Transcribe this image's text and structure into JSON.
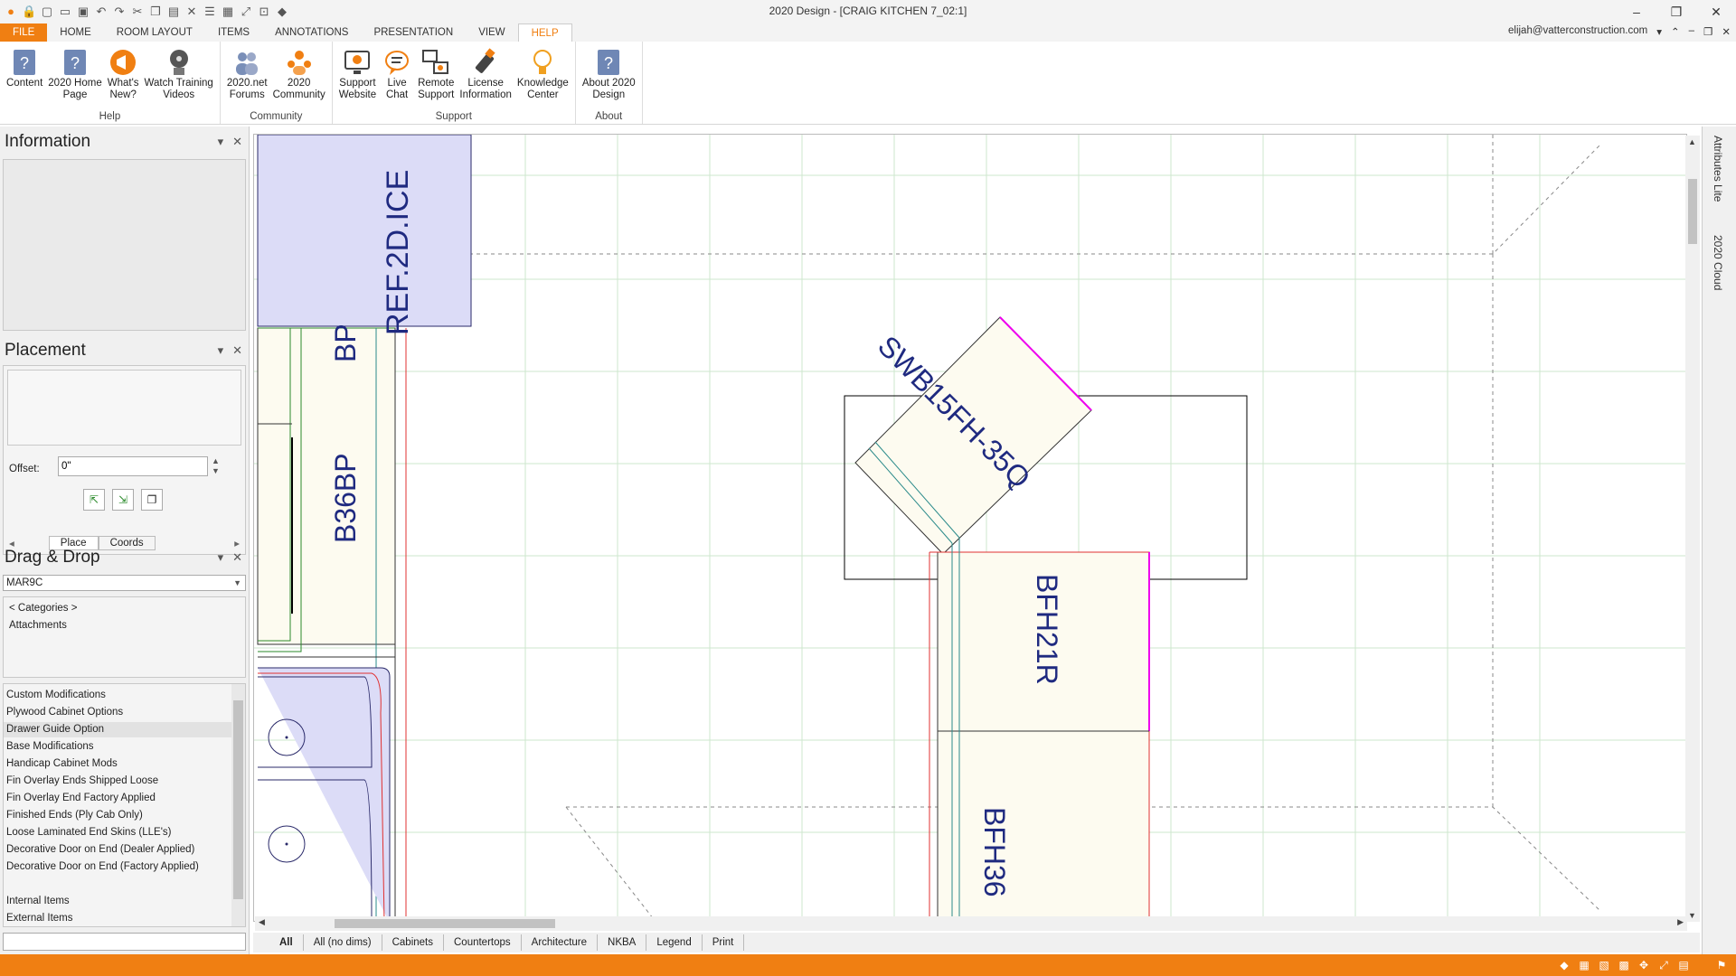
{
  "window": {
    "title": "2020 Design - [CRAIG KITCHEN 7_02:1]"
  },
  "tabs": [
    "FILE",
    "HOME",
    "ROOM LAYOUT",
    "ITEMS",
    "ANNOTATIONS",
    "PRESENTATION",
    "VIEW",
    "HELP"
  ],
  "account": {
    "email": "elijah@vatterconstruction.com"
  },
  "ribbon": {
    "help": {
      "label": "Help",
      "buttons": [
        "Content",
        "2020 Home\nPage",
        "What's\nNew?",
        "Watch Training\nVideos"
      ]
    },
    "community": {
      "label": "Community",
      "buttons": [
        "2020.net\nForums",
        "2020\nCommunity"
      ]
    },
    "support": {
      "label": "Support",
      "buttons": [
        "Support\nWebsite",
        "Live\nChat",
        "Remote\nSupport",
        "License\nInformation",
        "Knowledge\nCenter"
      ]
    },
    "about": {
      "label": "About",
      "buttons": [
        "About 2020\nDesign"
      ]
    }
  },
  "panels": {
    "information": {
      "title": "Information"
    },
    "placement": {
      "title": "Placement",
      "offset_label": "Offset:",
      "offset_value": "0\"",
      "tabs": [
        "Place",
        "Coords"
      ]
    },
    "dragdrop": {
      "title": "Drag & Drop",
      "catalog": "MAR9C",
      "categories": "< Categories >",
      "attachments": "Attachments",
      "items": [
        "Custom Modifications",
        "Plywood Cabinet Options",
        "Drawer Guide Option",
        "Base Modifications",
        "Handicap Cabinet Mods",
        "Fin Overlay Ends Shipped Loose",
        "Fin Overlay End Factory Applied",
        "Finished Ends (Ply Cab Only)",
        "Loose Laminated End Skins (LLE's)",
        "Decorative Door on End (Dealer Applied)",
        "Decorative Door on End (Factory Applied)",
        "",
        "Internal Items",
        "External Items"
      ]
    }
  },
  "canvas": {
    "labels": {
      "ref": "REF.2D.ICE",
      "bp_top": "BP",
      "b36bp": "B36BP",
      "swb": "SWB15FH-35Q",
      "bfh21r": "BFH21R",
      "bfh36": "BFH36"
    }
  },
  "view_tabs": [
    "All",
    "All (no dims)",
    "Cabinets",
    "Countertops",
    "Architecture",
    "NKBA",
    "Legend",
    "Print"
  ],
  "side_tabs": [
    "Attributes Lite",
    "2020 Cloud"
  ],
  "colors": {
    "accent": "#f07f12",
    "cabinet_fill": "#fdfbf0",
    "appliance_fill": "#dcdcf7",
    "label": "#1f2a80"
  }
}
